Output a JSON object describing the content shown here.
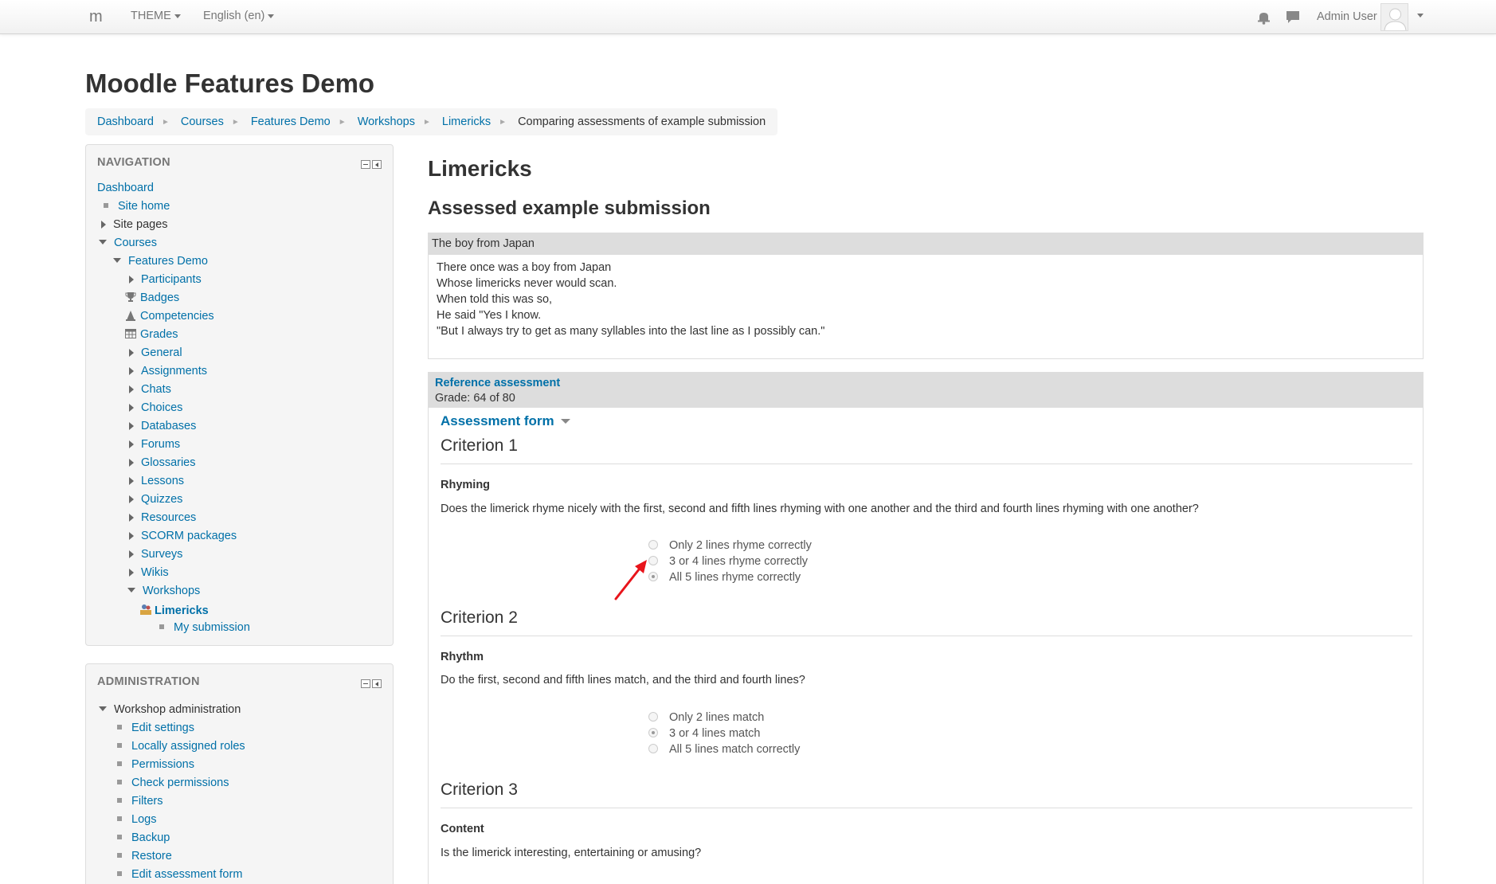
{
  "navbar": {
    "brand": "m",
    "theme_label": "THEME",
    "language_label": "English (en)",
    "user_name": "Admin User",
    "icons": [
      "bell-icon",
      "chat-icon",
      "avatar-icon",
      "chevron-down-icon"
    ]
  },
  "header": {
    "site_title": "Moodle Features Demo",
    "breadcrumb": [
      "Dashboard",
      "Courses",
      "Features Demo",
      "Workshops",
      "Limericks"
    ],
    "breadcrumb_current": "Comparing assessments of example submission"
  },
  "navigation": {
    "title": "NAVIGATION",
    "dashboard": "Dashboard",
    "site_home": "Site home",
    "site_pages": "Site pages",
    "courses": "Courses",
    "features_demo": "Features Demo",
    "participants": "Participants",
    "badges": "Badges",
    "competencies": "Competencies",
    "grades": "Grades",
    "general": "General",
    "assignments": "Assignments",
    "chats": "Chats",
    "choices": "Choices",
    "databases": "Databases",
    "forums": "Forums",
    "glossaries": "Glossaries",
    "lessons": "Lessons",
    "quizzes": "Quizzes",
    "resources": "Resources",
    "scorm": "SCORM packages",
    "surveys": "Surveys",
    "wikis": "Wikis",
    "workshops": "Workshops",
    "limericks": "Limericks",
    "my_submission": "My submission"
  },
  "administration": {
    "title": "ADMINISTRATION",
    "workshop_admin": "Workshop administration",
    "edit_settings": "Edit settings",
    "local_roles": "Locally assigned roles",
    "permissions": "Permissions",
    "check_permissions": "Check permissions",
    "filters": "Filters",
    "logs": "Logs",
    "backup": "Backup",
    "restore": "Restore",
    "edit_form": "Edit assessment form"
  },
  "main": {
    "heading": "Limericks",
    "subheading": "Assessed example submission",
    "submission": {
      "title": "The boy from Japan",
      "lines": [
        "There once was a boy from Japan",
        "Whose limericks never would scan.",
        "When told this was so,",
        "He said \"Yes I know.",
        "\"But I always try to get as many syllables into the last line as I possibly can.\""
      ]
    },
    "reference": {
      "title": "Reference assessment",
      "grade": "Grade: 64 of 80",
      "form_title": "Assessment form"
    },
    "criteria": [
      {
        "heading": "Criterion 1",
        "name": "Rhyming",
        "description": "Does the limerick rhyme nicely with the first, second and fifth lines rhyming with one another and the third and fourth lines rhyming with one another?",
        "options": [
          "Only 2 lines rhyme correctly",
          "3 or 4 lines rhyme correctly",
          "All 5 lines rhyme correctly"
        ],
        "selected": 2
      },
      {
        "heading": "Criterion 2",
        "name": "Rhythm",
        "description": "Do the first, second and fifth lines match, and the third and fourth lines?",
        "options": [
          "Only 2 lines match",
          "3 or 4 lines match",
          "All 5 lines match correctly"
        ],
        "selected": 1
      },
      {
        "heading": "Criterion 3",
        "name": "Content",
        "description": "Is the limerick interesting, entertaining or amusing?"
      }
    ]
  },
  "colors": {
    "link": "#0070a8",
    "annotation_arrow": "#e8141b"
  }
}
